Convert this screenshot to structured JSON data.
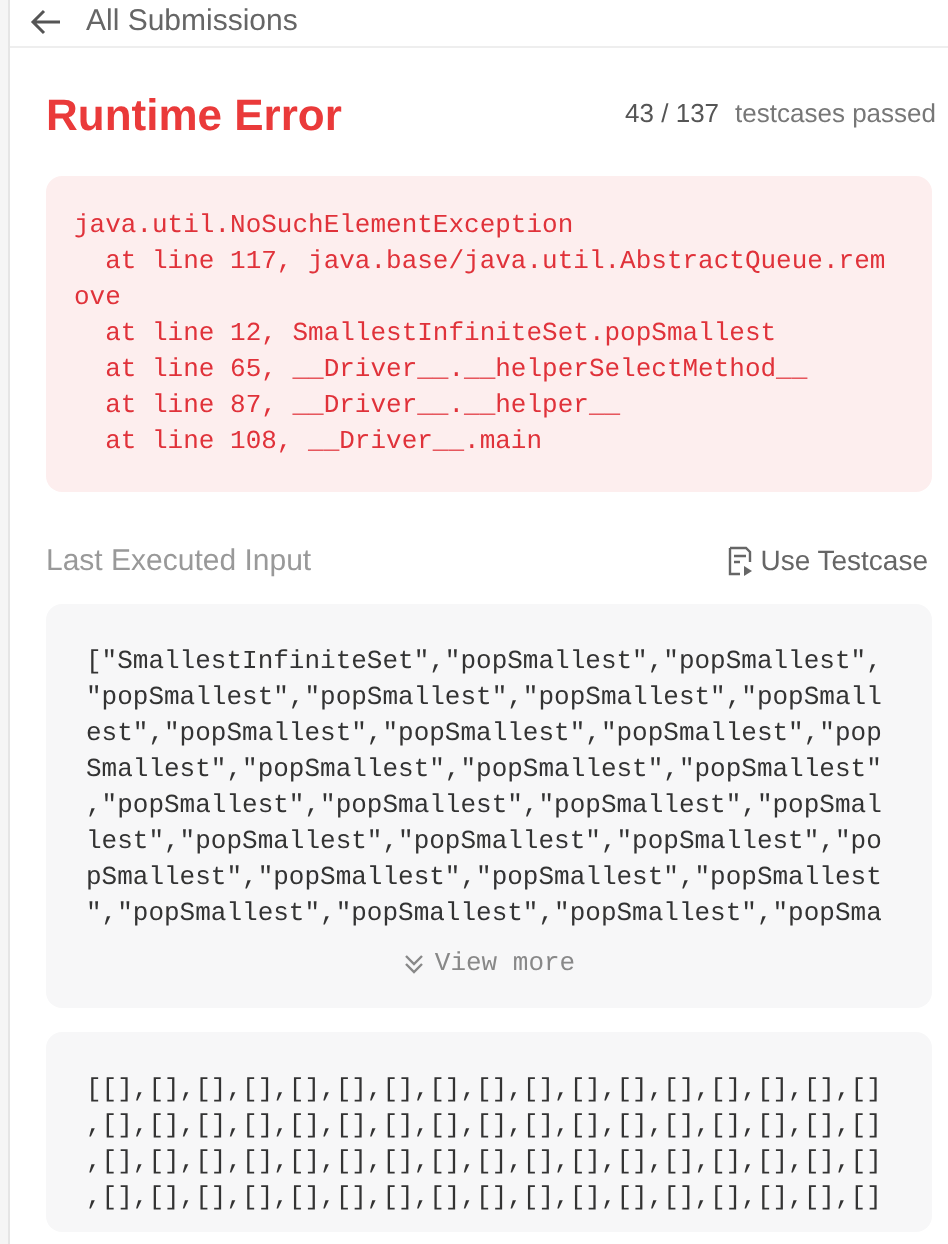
{
  "header": {
    "back_label": "All Submissions"
  },
  "result": {
    "status": "Runtime Error",
    "passed": "43 / 137",
    "passed_label": "testcases passed"
  },
  "error_lines": [
    "java.util.NoSuchElementException",
    "  at line 117, java.base/java.util.AbstractQueue.rem",
    "ove",
    "  at line 12, SmallestInfiniteSet.popSmallest",
    "  at line 65, __Driver__.__helperSelectMethod__",
    "  at line 87, __Driver__.__helper__",
    "  at line 108, __Driver__.main"
  ],
  "last_input": {
    "title": "Last Executed Input",
    "use_testcase": "Use Testcase",
    "view_more": "View more",
    "blocks": [
      {
        "lines": [
          "[\"SmallestInfiniteSet\",\"popSmallest\",\"popSmallest\",",
          "\"popSmallest\",\"popSmallest\",\"popSmallest\",\"popSmall",
          "est\",\"popSmallest\",\"popSmallest\",\"popSmallest\",\"pop",
          "Smallest\",\"popSmallest\",\"popSmallest\",\"popSmallest\"",
          ",\"popSmallest\",\"popSmallest\",\"popSmallest\",\"popSmal",
          "lest\",\"popSmallest\",\"popSmallest\",\"popSmallest\",\"po",
          "pSmallest\",\"popSmallest\",\"popSmallest\",\"popSmallest",
          "\",\"popSmallest\",\"popSmallest\",\"popSmallest\",\"popSma"
        ],
        "collapsed": true
      },
      {
        "lines": [
          "[[],[],[],[],[],[],[],[],[],[],[],[],[],[],[],[],[]",
          ",[],[],[],[],[],[],[],[],[],[],[],[],[],[],[],[],[]",
          ",[],[],[],[],[],[],[],[],[],[],[],[],[],[],[],[],[]",
          ",[],[],[],[],[],[],[],[],[],[],[],[],[],[],[],[],[]"
        ],
        "collapsed": false
      }
    ]
  }
}
